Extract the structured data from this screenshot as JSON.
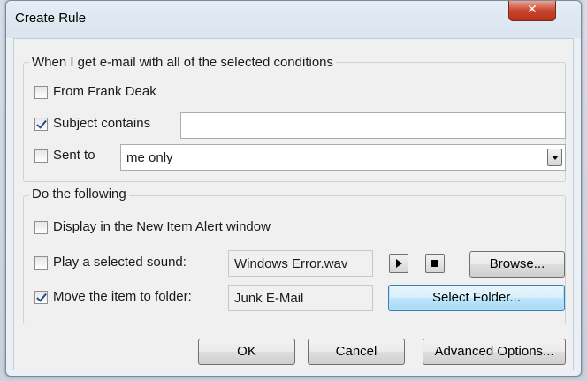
{
  "window": {
    "title": "Create Rule",
    "close_glyph": "✕"
  },
  "conditions": {
    "group_label": "When I get e-mail with all of the selected conditions",
    "from": {
      "label": "From Frank Deak",
      "checked": false
    },
    "subject": {
      "label": "Subject contains",
      "checked": true,
      "value": ""
    },
    "sent_to": {
      "label": "Sent to",
      "checked": false,
      "selected": "me only"
    }
  },
  "actions": {
    "group_label": "Do the following",
    "alert": {
      "label": "Display in the New Item Alert window",
      "checked": false
    },
    "sound": {
      "label": "Play a selected sound:",
      "checked": false,
      "value": "Windows Error.wav",
      "browse_label": "Browse..."
    },
    "move": {
      "label": "Move the item to folder:",
      "checked": true,
      "value": "Junk E-Mail",
      "select_label": "Select Folder..."
    }
  },
  "footer": {
    "ok_label": "OK",
    "cancel_label": "Cancel",
    "advanced_label": "Advanced Options..."
  },
  "icons": [
    "close-icon",
    "checkmark-icon",
    "play-icon",
    "stop-icon",
    "chevron-down-icon"
  ]
}
